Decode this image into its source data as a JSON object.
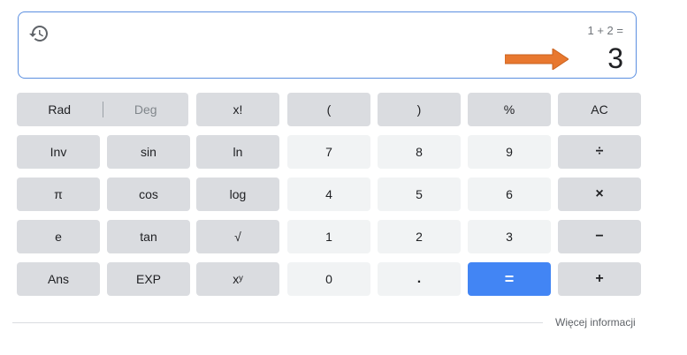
{
  "display": {
    "expression": "1 + 2 =",
    "result": "3",
    "history_icon": "history-icon",
    "arrow_color": "#e8782f"
  },
  "keys": {
    "rad": "Rad",
    "deg": "Deg",
    "factorial": "x!",
    "open_paren": "(",
    "close_paren": ")",
    "percent": "%",
    "ac": "AC",
    "inv": "Inv",
    "sin": "sin",
    "ln": "ln",
    "seven": "7",
    "eight": "8",
    "nine": "9",
    "divide": "÷",
    "pi": "π",
    "cos": "cos",
    "log": "log",
    "four": "4",
    "five": "5",
    "six": "6",
    "multiply": "×",
    "e": "e",
    "tan": "tan",
    "sqrt": "√",
    "one": "1",
    "two": "2",
    "three": "3",
    "minus": "−",
    "ans": "Ans",
    "exp": "EXP",
    "power": "xʸ",
    "zero": "0",
    "dot": ".",
    "equals": "=",
    "plus": "+"
  },
  "footer": {
    "more_info": "Więcej informacji"
  },
  "colors": {
    "dark_key": "#dadce0",
    "light_key": "#f1f3f4",
    "equals_key": "#4285f4",
    "display_border": "#5b8fe0"
  }
}
